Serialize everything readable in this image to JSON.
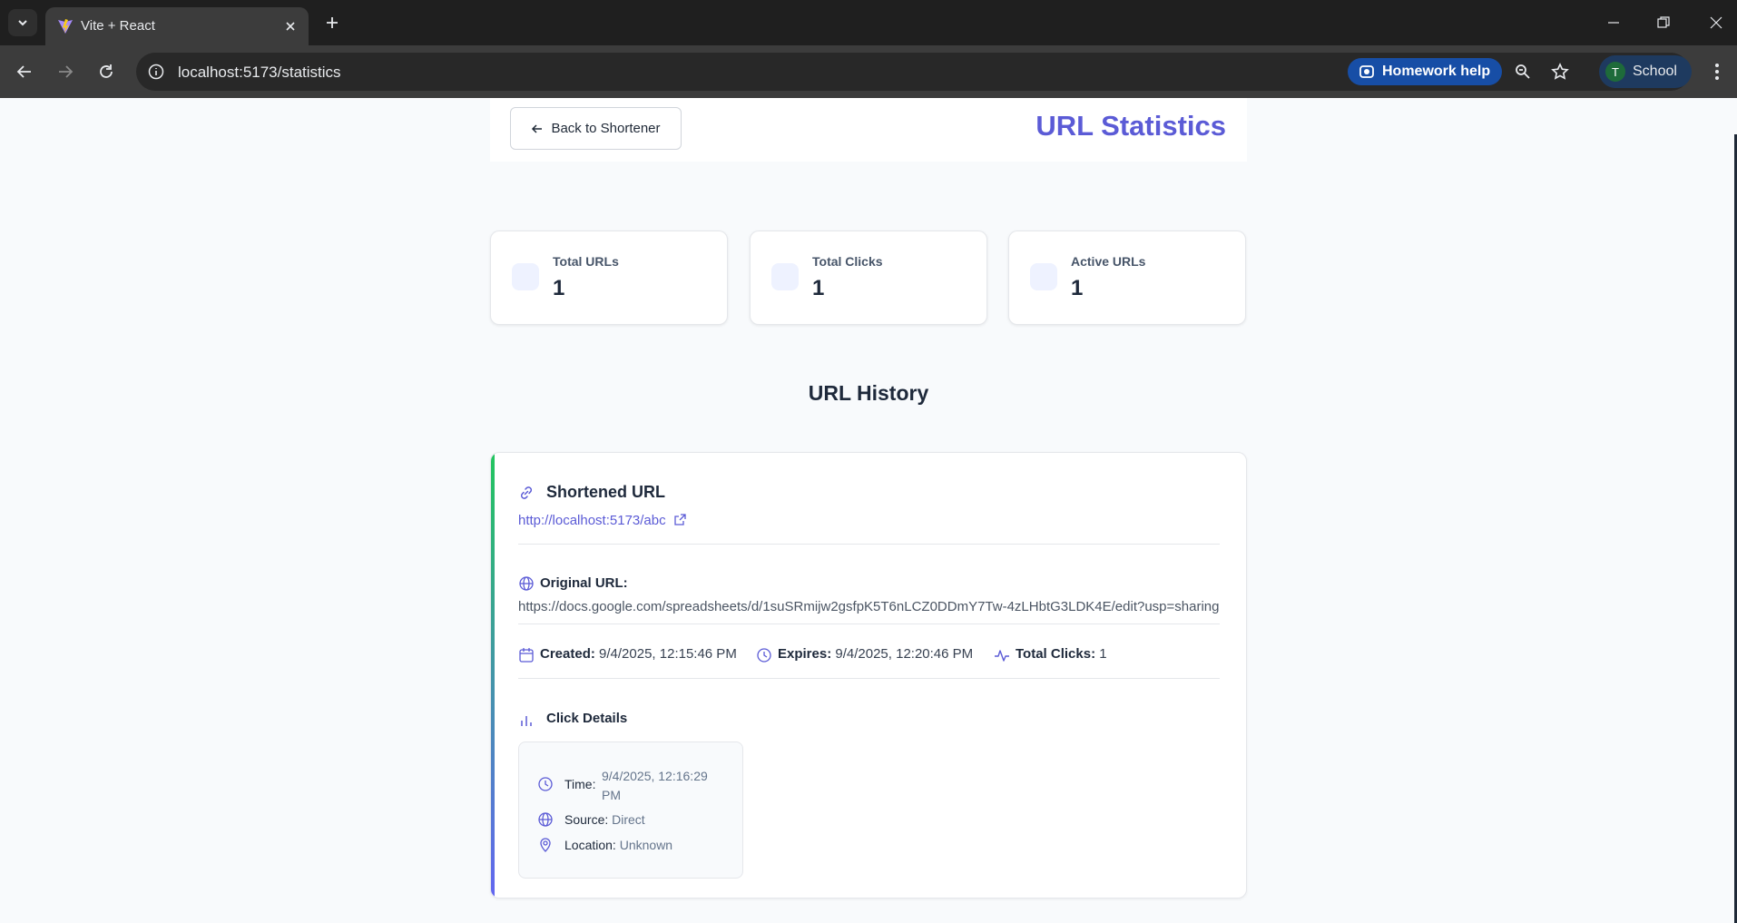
{
  "browser": {
    "tab_title": "Vite + React",
    "url": "localhost:5173/statistics",
    "homework_help": "Homework help",
    "profile_initial": "T",
    "profile_name": "School"
  },
  "header": {
    "back_label": "Back to Shortener",
    "title": "URL Statistics"
  },
  "stats": [
    {
      "label": "Total URLs",
      "value": "1"
    },
    {
      "label": "Total Clicks",
      "value": "1"
    },
    {
      "label": "Active URLs",
      "value": "1"
    }
  ],
  "history": {
    "title": "URL History",
    "card": {
      "short_title": "Shortened URL",
      "short_url": "http://localhost:5173/abc",
      "original_label": "Original URL:",
      "original_url": "https://docs.google.com/spreadsheets/d/1suSRmijw2gsfpK5T6nLCZ0DDmY7Tw-4zLHbtG3LDK4E/edit?usp=sharing",
      "created_label": "Created:",
      "created_value": "9/4/2025, 12:15:46 PM",
      "expires_label": "Expires:",
      "expires_value": "9/4/2025, 12:20:46 PM",
      "clicks_label": "Total Clicks:",
      "clicks_value": "1",
      "click_details_title": "Click Details",
      "click": {
        "time_label": "Time:",
        "time_value": "9/4/2025, 12:16:29 PM",
        "source_label": "Source:",
        "source_value": "Direct",
        "location_label": "Location:",
        "location_value": "Unknown"
      }
    }
  },
  "colors": {
    "accent": "#5b5bd6",
    "accent_bar_top": "#22c55e",
    "accent_bar_bottom": "#6366f1"
  }
}
